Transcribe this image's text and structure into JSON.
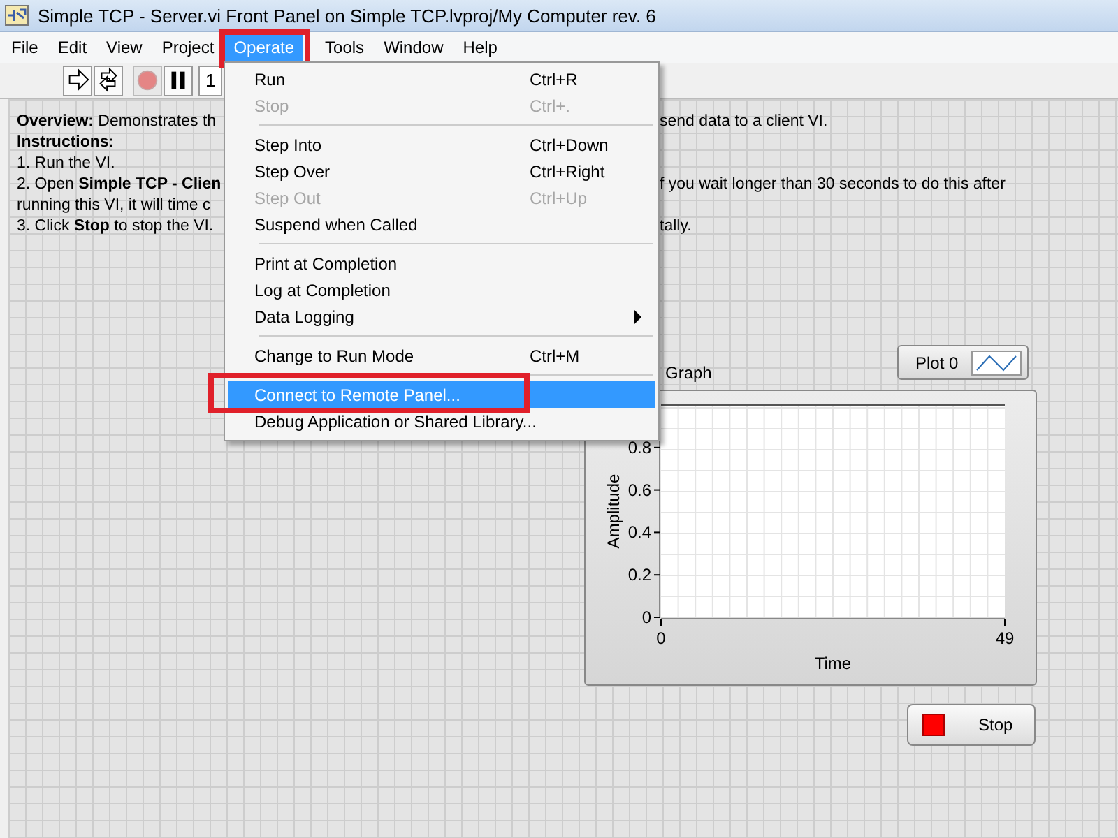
{
  "window": {
    "title": "Simple TCP - Server.vi Front Panel on Simple TCP.lvproj/My Computer rev. 6"
  },
  "menubar": [
    {
      "label": "File",
      "selected": false,
      "highlighted": false
    },
    {
      "label": "Edit",
      "selected": false,
      "highlighted": false
    },
    {
      "label": "View",
      "selected": false,
      "highlighted": false
    },
    {
      "label": "Project",
      "selected": false,
      "highlighted": false
    },
    {
      "label": "Operate",
      "selected": true,
      "highlighted": true
    },
    {
      "label": "Tools",
      "selected": false,
      "highlighted": false
    },
    {
      "label": "Window",
      "selected": false,
      "highlighted": false
    },
    {
      "label": "Help",
      "selected": false,
      "highlighted": false
    }
  ],
  "toolbar": [
    {
      "kind": "run",
      "disabled": false
    },
    {
      "kind": "run-continuously",
      "disabled": false
    },
    {
      "kind": "abort",
      "disabled": true
    },
    {
      "kind": "pause",
      "disabled": false
    }
  ],
  "toolbar_field": "1",
  "instructions": [
    {
      "left": "**Overview:** Demonstrates th",
      "right": "send data to a client VI."
    },
    {
      "left": "**Instructions:**"
    },
    {
      "left": "1. Run the VI."
    },
    {
      "left": "2. Open **Simple TCP - Clien**",
      "right": "f you wait longer than 30 seconds to do this after"
    },
    {
      "left": "running this VI, it will time c"
    },
    {
      "left": "3. Click **Stop** to stop the VI.",
      "right": "tally."
    }
  ],
  "menu": [
    {
      "kind": "item",
      "label": "Run",
      "shortcut": "Ctrl+R",
      "disabled": false,
      "selected": false,
      "submenu": false,
      "highlighted": false
    },
    {
      "kind": "item",
      "label": "Stop",
      "shortcut": "Ctrl+.",
      "disabled": true,
      "selected": false,
      "submenu": false,
      "highlighted": false
    },
    {
      "kind": "separator"
    },
    {
      "kind": "item",
      "label": "Step Into",
      "shortcut": "Ctrl+Down",
      "disabled": false,
      "selected": false,
      "submenu": false,
      "highlighted": false
    },
    {
      "kind": "item",
      "label": "Step Over",
      "shortcut": "Ctrl+Right",
      "disabled": false,
      "selected": false,
      "submenu": false,
      "highlighted": false
    },
    {
      "kind": "item",
      "label": "Step Out",
      "shortcut": "Ctrl+Up",
      "disabled": true,
      "selected": false,
      "submenu": false,
      "highlighted": false
    },
    {
      "kind": "item",
      "label": "Suspend when Called",
      "disabled": false,
      "selected": false,
      "submenu": false,
      "highlighted": false
    },
    {
      "kind": "separator"
    },
    {
      "kind": "item",
      "label": "Print at Completion",
      "disabled": false,
      "selected": false,
      "submenu": false,
      "highlighted": false
    },
    {
      "kind": "item",
      "label": "Log at Completion",
      "disabled": false,
      "selected": false,
      "submenu": false,
      "highlighted": false
    },
    {
      "kind": "item",
      "label": "Data Logging",
      "disabled": false,
      "selected": false,
      "submenu": true,
      "highlighted": false
    },
    {
      "kind": "separator"
    },
    {
      "kind": "item",
      "label": "Change to Run Mode",
      "shortcut": "Ctrl+M",
      "disabled": false,
      "selected": false,
      "submenu": false,
      "highlighted": false
    },
    {
      "kind": "separator"
    },
    {
      "kind": "item",
      "label": "Connect to Remote Panel...",
      "disabled": false,
      "selected": true,
      "submenu": false,
      "highlighted": true
    },
    {
      "kind": "item",
      "label": "Debug Application or Shared Library...",
      "disabled": false,
      "selected": false,
      "submenu": false,
      "highlighted": false
    }
  ],
  "graph": {
    "label": "Graph",
    "legend": "Plot 0",
    "chart_data": {
      "type": "line",
      "grid": true,
      "xlabel": "Time",
      "ylabel": "Amplitude",
      "xlim": [
        0,
        49
      ],
      "ylim": [
        0,
        1
      ],
      "xticks": [
        0,
        49
      ],
      "yticks": [
        0,
        0.2,
        0.4,
        0.6,
        0.8
      ]
    }
  },
  "stop_button": {
    "label": "Stop"
  }
}
